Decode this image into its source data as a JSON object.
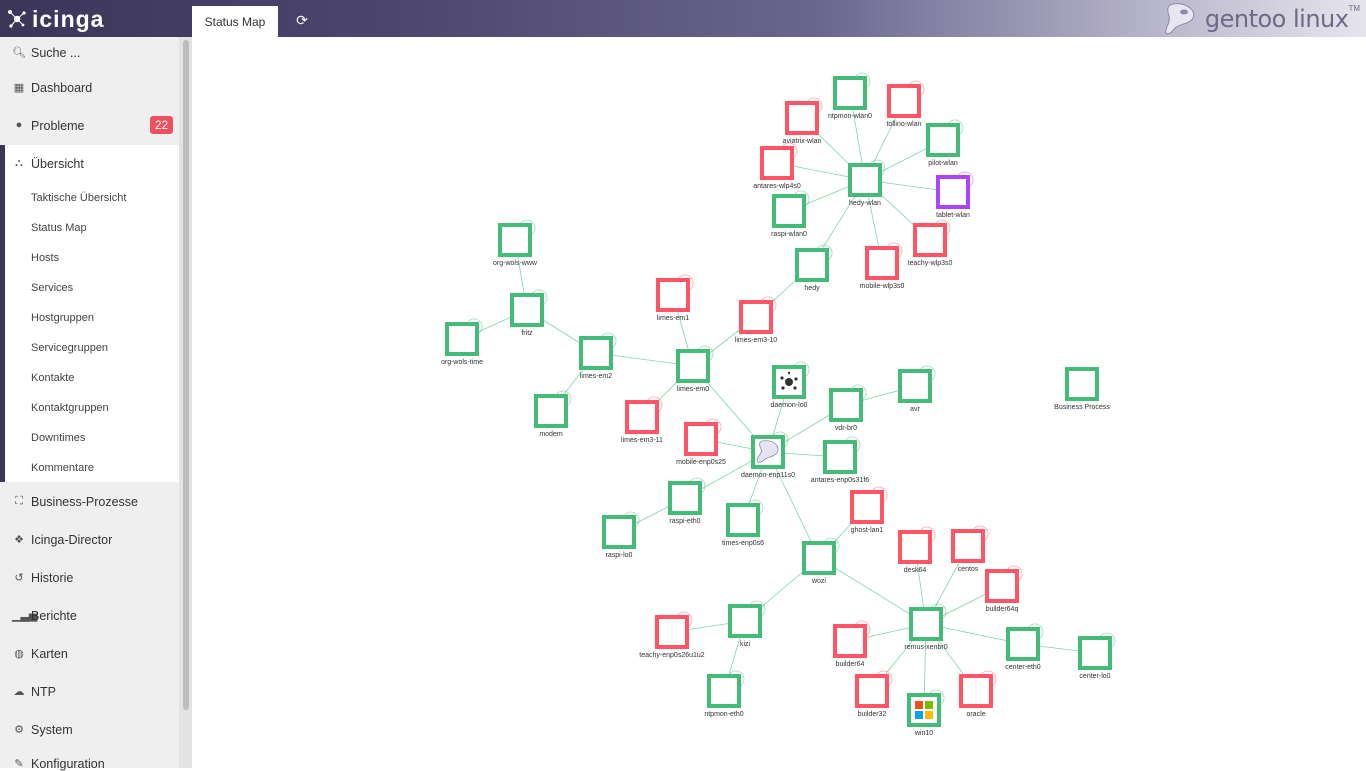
{
  "header": {
    "app_name": "icinga",
    "tab_label": "Status Map",
    "brand_text": "gentoo linux",
    "brand_tm": "TM"
  },
  "sidebar": {
    "search_label": "Suche ...",
    "dashboard": "Dashboard",
    "problems": "Probleme",
    "problems_count": "22",
    "overview": "Übersicht",
    "overview_items": [
      "Taktische Übersicht",
      "Status Map",
      "Hosts",
      "Services",
      "Hostgruppen",
      "Servicegruppen",
      "Kontakte",
      "Kontaktgruppen",
      "Downtimes",
      "Kommentare"
    ],
    "business": "Business-Prozesse",
    "director": "Icinga-Director",
    "history": "Historie",
    "reports": "Berichte",
    "maps": "Karten",
    "ntp": "NTP",
    "system": "System",
    "config": "Konfiguration"
  },
  "colors": {
    "ok": "#44bb77",
    "down": "#ff5566",
    "unknown": "#aa44ff",
    "edge": "#7fd6a8",
    "accent": "#3b3558"
  },
  "map": {
    "nodes": [
      {
        "id": "ntpmon-wlan0",
        "status": "ok"
      },
      {
        "id": "tollino-wlan",
        "status": "down"
      },
      {
        "id": "aviatrix-wlan",
        "status": "down"
      },
      {
        "id": "pilot-wlan",
        "status": "ok"
      },
      {
        "id": "antares-wlp4s0",
        "status": "down"
      },
      {
        "id": "hedy-wlan",
        "status": "ok"
      },
      {
        "id": "tablet-wlan",
        "status": "unknown"
      },
      {
        "id": "raspi-wlan0",
        "status": "ok"
      },
      {
        "id": "teachy-wlp3s0",
        "status": "down"
      },
      {
        "id": "hedy",
        "status": "ok"
      },
      {
        "id": "mobile-wlp3s0",
        "status": "down"
      },
      {
        "id": "org-wols-www",
        "status": "ok"
      },
      {
        "id": "limes-em1",
        "status": "down"
      },
      {
        "id": "limes-em3-10",
        "status": "down"
      },
      {
        "id": "fritz",
        "status": "ok"
      },
      {
        "id": "org-wols-time",
        "status": "ok"
      },
      {
        "id": "limes-em2",
        "status": "ok"
      },
      {
        "id": "limes-em0",
        "status": "ok"
      },
      {
        "id": "daemon-lo0",
        "status": "ok",
        "icon": "dots"
      },
      {
        "id": "avr",
        "status": "ok"
      },
      {
        "id": "Business Process",
        "status": "ok"
      },
      {
        "id": "vdr-br0",
        "status": "ok"
      },
      {
        "id": "modem",
        "status": "ok"
      },
      {
        "id": "limes-em3-11",
        "status": "down"
      },
      {
        "id": "mobile-enp0s25",
        "status": "down"
      },
      {
        "id": "daemon-enp11s0",
        "status": "ok",
        "icon": "gentoo"
      },
      {
        "id": "antares-enp0s31f6",
        "status": "ok"
      },
      {
        "id": "raspi-eth0",
        "status": "ok"
      },
      {
        "id": "ghost-lan1",
        "status": "down"
      },
      {
        "id": "times-enp0s6",
        "status": "ok"
      },
      {
        "id": "raspi-lo0",
        "status": "ok"
      },
      {
        "id": "desk64",
        "status": "down"
      },
      {
        "id": "centos",
        "status": "down"
      },
      {
        "id": "wozi",
        "status": "ok"
      },
      {
        "id": "builder64q",
        "status": "down"
      },
      {
        "id": "kizi",
        "status": "ok"
      },
      {
        "id": "remus-xenbr0",
        "status": "ok"
      },
      {
        "id": "teachy-enp0s26u1u2",
        "status": "down"
      },
      {
        "id": "builder64",
        "status": "down"
      },
      {
        "id": "center-eth0",
        "status": "ok"
      },
      {
        "id": "center-lo0",
        "status": "ok"
      },
      {
        "id": "ntpmon-eth0",
        "status": "ok"
      },
      {
        "id": "builder32",
        "status": "down"
      },
      {
        "id": "oracle",
        "status": "down"
      },
      {
        "id": "win10",
        "status": "ok",
        "icon": "windows"
      }
    ],
    "edges": [
      [
        "hedy-wlan",
        "ntpmon-wlan0"
      ],
      [
        "hedy-wlan",
        "tollino-wlan"
      ],
      [
        "hedy-wlan",
        "aviatrix-wlan"
      ],
      [
        "hedy-wlan",
        "pilot-wlan"
      ],
      [
        "hedy-wlan",
        "antares-wlp4s0"
      ],
      [
        "hedy-wlan",
        "tablet-wlan"
      ],
      [
        "hedy-wlan",
        "raspi-wlan0"
      ],
      [
        "hedy-wlan",
        "teachy-wlp3s0"
      ],
      [
        "hedy-wlan",
        "mobile-wlp3s0"
      ],
      [
        "hedy-wlan",
        "hedy"
      ],
      [
        "hedy",
        "limes-em3-10"
      ],
      [
        "limes-em3-10",
        "limes-em0"
      ],
      [
        "limes-em1",
        "limes-em0"
      ],
      [
        "limes-em0",
        "limes-em2"
      ],
      [
        "limes-em2",
        "fritz"
      ],
      [
        "fritz",
        "org-wols-www"
      ],
      [
        "fritz",
        "org-wols-time"
      ],
      [
        "limes-em2",
        "modem"
      ],
      [
        "limes-em0",
        "limes-em3-11"
      ],
      [
        "limes-em0",
        "daemon-enp11s0"
      ],
      [
        "daemon-enp11s0",
        "daemon-lo0"
      ],
      [
        "daemon-enp11s0",
        "vdr-br0"
      ],
      [
        "vdr-br0",
        "avr"
      ],
      [
        "daemon-enp11s0",
        "mobile-enp0s25"
      ],
      [
        "daemon-enp11s0",
        "antares-enp0s31f6"
      ],
      [
        "daemon-enp11s0",
        "raspi-eth0"
      ],
      [
        "raspi-eth0",
        "raspi-lo0"
      ],
      [
        "daemon-enp11s0",
        "times-enp0s6"
      ],
      [
        "daemon-enp11s0",
        "wozi"
      ],
      [
        "wozi",
        "ghost-lan1"
      ],
      [
        "wozi",
        "kizi"
      ],
      [
        "kizi",
        "teachy-enp0s26u1u2"
      ],
      [
        "kizi",
        "ntpmon-eth0"
      ],
      [
        "wozi",
        "remus-xenbr0"
      ],
      [
        "remus-xenbr0",
        "desk64"
      ],
      [
        "remus-xenbr0",
        "centos"
      ],
      [
        "remus-xenbr0",
        "builder64q"
      ],
      [
        "remus-xenbr0",
        "builder64"
      ],
      [
        "remus-xenbr0",
        "center-eth0"
      ],
      [
        "center-eth0",
        "center-lo0"
      ],
      [
        "remus-xenbr0",
        "builder32"
      ],
      [
        "remus-xenbr0",
        "oracle"
      ],
      [
        "remus-xenbr0",
        "win10"
      ]
    ]
  }
}
